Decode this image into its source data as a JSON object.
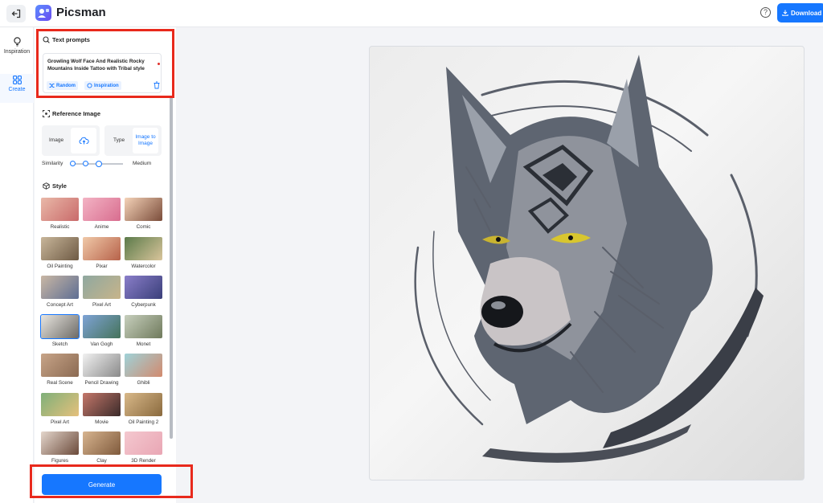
{
  "app": {
    "brand": "Picsman"
  },
  "header": {
    "download_label": "Download",
    "help_glyph": "?"
  },
  "nav": [
    {
      "label": "Inspiration",
      "icon": "lightbulb-icon"
    },
    {
      "label": "Create",
      "icon": "grid-icon",
      "active": true
    }
  ],
  "text_prompts": {
    "heading": "Text prompts",
    "prompt": "Growling Wolf Face And Realistic Rocky Mountains Inside Tattoo with Tribal style",
    "random_label": "Random",
    "inspiration_label": "Inspiration"
  },
  "reference_image": {
    "heading": "Reference Image",
    "image_label": "Image",
    "type_label": "Type",
    "type_value": "Image to Image",
    "similarity_label": "Similarity",
    "similarity_value": "Medium",
    "similarity_level_fraction": 0.5
  },
  "style": {
    "heading": "Style",
    "selected": "Sketch",
    "items": [
      "Realistic",
      "Anime",
      "Comic",
      "Oil Painting",
      "Pixar",
      "Watercolor",
      "Concept Art",
      "Pixel Art",
      "Cyberpunk",
      "Sketch",
      "Van Gogh",
      "Monet",
      "Real Scene",
      "Pencil Drawing",
      "Ghibli",
      "Pixel Art",
      "Movie",
      "Oil Painting 2",
      "Figures",
      "Clay",
      "3D Render"
    ]
  },
  "generate_label": "Generate",
  "colors": {
    "accent": "#1677ff",
    "highlight": "#e8291c"
  }
}
